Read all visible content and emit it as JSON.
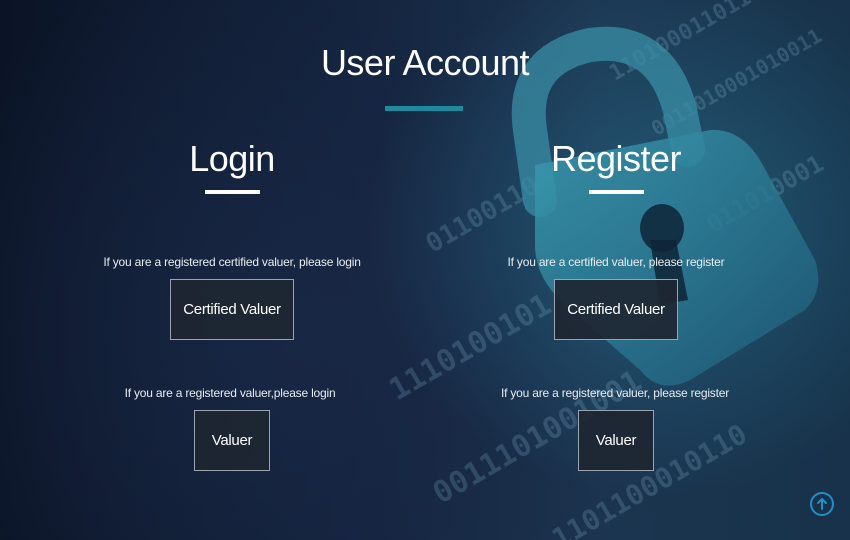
{
  "page": {
    "title": "User Account"
  },
  "login": {
    "heading": "Login",
    "certified_hint": "If you are a registered certified valuer, please login",
    "certified_button": "Certified Valuer",
    "valuer_hint": "If you are a registered valuer,please login",
    "valuer_button": "Valuer"
  },
  "register": {
    "heading": "Register",
    "certified_hint": "If you are a certified valuer, please register",
    "certified_button": "Certified Valuer",
    "valuer_hint": "If you are a registered valuer, please register",
    "valuer_button": "Valuer"
  },
  "icons": {
    "scroll_top": "arrow-up-circle-icon",
    "background": "padlock-icon"
  },
  "colors": {
    "accent": "#1d8aa0",
    "scroll_top": "#1e90c8",
    "button_border": "#9aa4ae"
  }
}
